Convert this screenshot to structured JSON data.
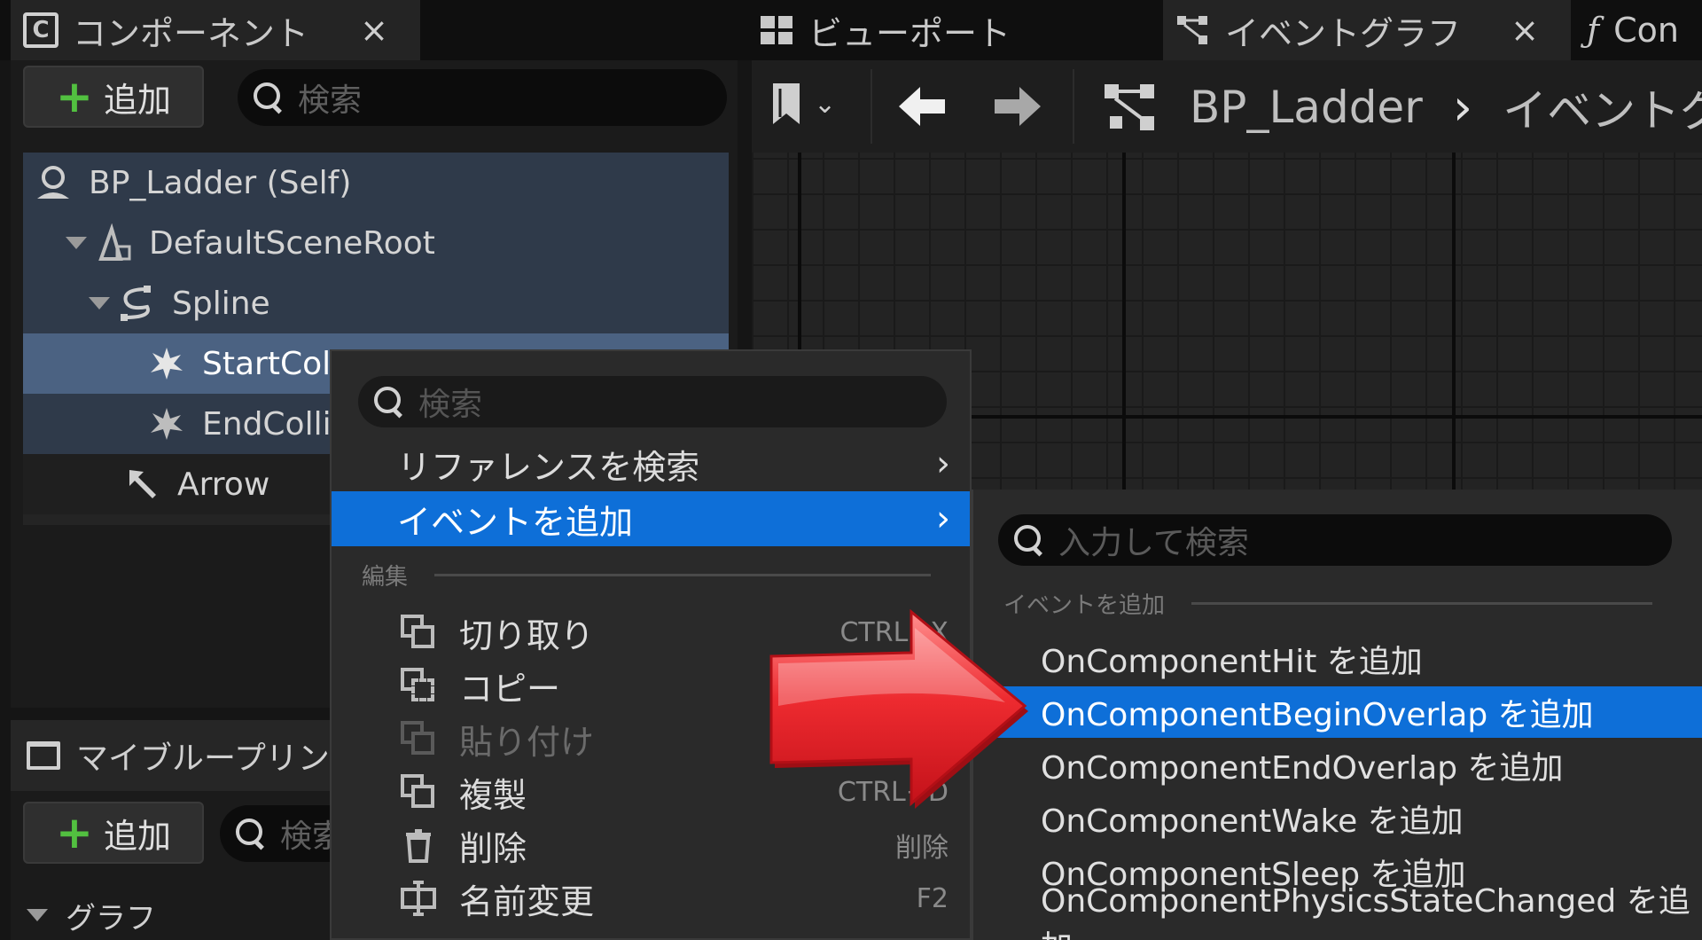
{
  "tabs": {
    "components": {
      "label": "コンポーネント",
      "close": "×"
    },
    "viewport": {
      "label": "ビューポート"
    },
    "event_graph": {
      "label": "イベントグラフ",
      "close": "×"
    },
    "construction": {
      "label": "Con"
    }
  },
  "components_panel": {
    "add_label": "追加",
    "search_placeholder": "検索",
    "tree": [
      {
        "label": "BP_Ladder (Self)",
        "icon": "actor-icon"
      },
      {
        "label": "DefaultSceneRoot",
        "icon": "scene-root-icon"
      },
      {
        "label": "Spline",
        "icon": "spline-icon"
      },
      {
        "label": "StartColl",
        "icon": "collision-icon"
      },
      {
        "label": "EndCollis",
        "icon": "collision-icon"
      },
      {
        "label": "Arrow",
        "icon": "arrow-component-icon"
      }
    ]
  },
  "my_blueprint": {
    "title": "マイブループリント",
    "add_label": "追加",
    "search_placeholder": "検索",
    "graph_section": "グラフ"
  },
  "graph_toolbar": {
    "breadcrumb_root": "BP_Ladder",
    "breadcrumb_sep": "›",
    "breadcrumb_current": "イベントグ"
  },
  "context_menu": {
    "search_placeholder": "検索",
    "find_references": "リファレンスを検索",
    "add_event": "イベントを追加",
    "section_edit": "編集",
    "items": [
      {
        "label": "切り取り",
        "shortcut": "CTRL+X"
      },
      {
        "label": "コピー",
        "shortcut": ""
      },
      {
        "label": "貼り付け",
        "shortcut": ""
      },
      {
        "label": "複製",
        "shortcut": "CTRL+D"
      },
      {
        "label": "削除",
        "shortcut": "削除"
      },
      {
        "label": "名前変更",
        "shortcut": "F2"
      }
    ]
  },
  "submenu": {
    "search_placeholder": "入力して検索",
    "section": "イベントを追加",
    "items": [
      "OnComponentHit を追加",
      "OnComponentBeginOverlap を追加",
      "OnComponentEndOverlap を追加",
      "OnComponentWake を追加",
      "OnComponentSleep を追加",
      "OnComponentPhysicsStateChanged を追加"
    ]
  },
  "colors": {
    "selection_blue": "#0e6fd8",
    "tree_selected": "#4b6282",
    "add_plus_green": "#52c040",
    "annotation_arrow_red": "#e8202a"
  }
}
